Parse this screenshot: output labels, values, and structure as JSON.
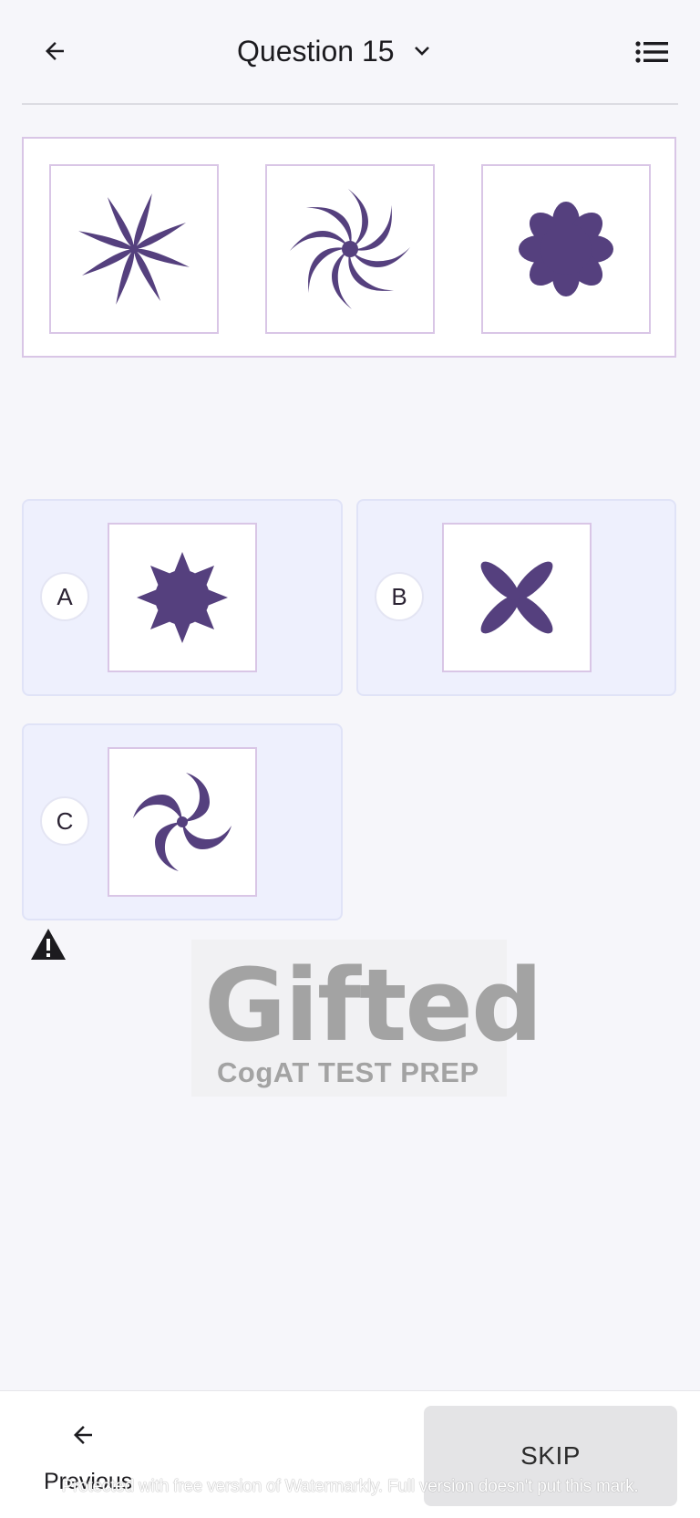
{
  "header": {
    "title": "Question 15",
    "back_icon": "arrow-left-icon",
    "dropdown_icon": "chevron-down-icon",
    "list_icon": "list-icon"
  },
  "question": {
    "figures": [
      "eight-ray-star",
      "spiral-eight-arms",
      "eight-petal-flower"
    ]
  },
  "answers": [
    {
      "letter": "A",
      "figure": "eight-point-star"
    },
    {
      "letter": "B",
      "figure": "four-petal-x"
    },
    {
      "letter": "C",
      "figure": "spiral-four-arms"
    }
  ],
  "logo": {
    "word": "Gifted",
    "subtitle": "CogAT TEST PREP"
  },
  "footer": {
    "previous_label": "Previous",
    "skip_label": "SKIP",
    "watermark_text": "Protected with free version of Watermarkly. Full version doesn't put this mark."
  },
  "colors": {
    "accent_purple": "#55407e",
    "card_bg": "#eef0fd",
    "border_lilac": "#d9c6e6"
  }
}
